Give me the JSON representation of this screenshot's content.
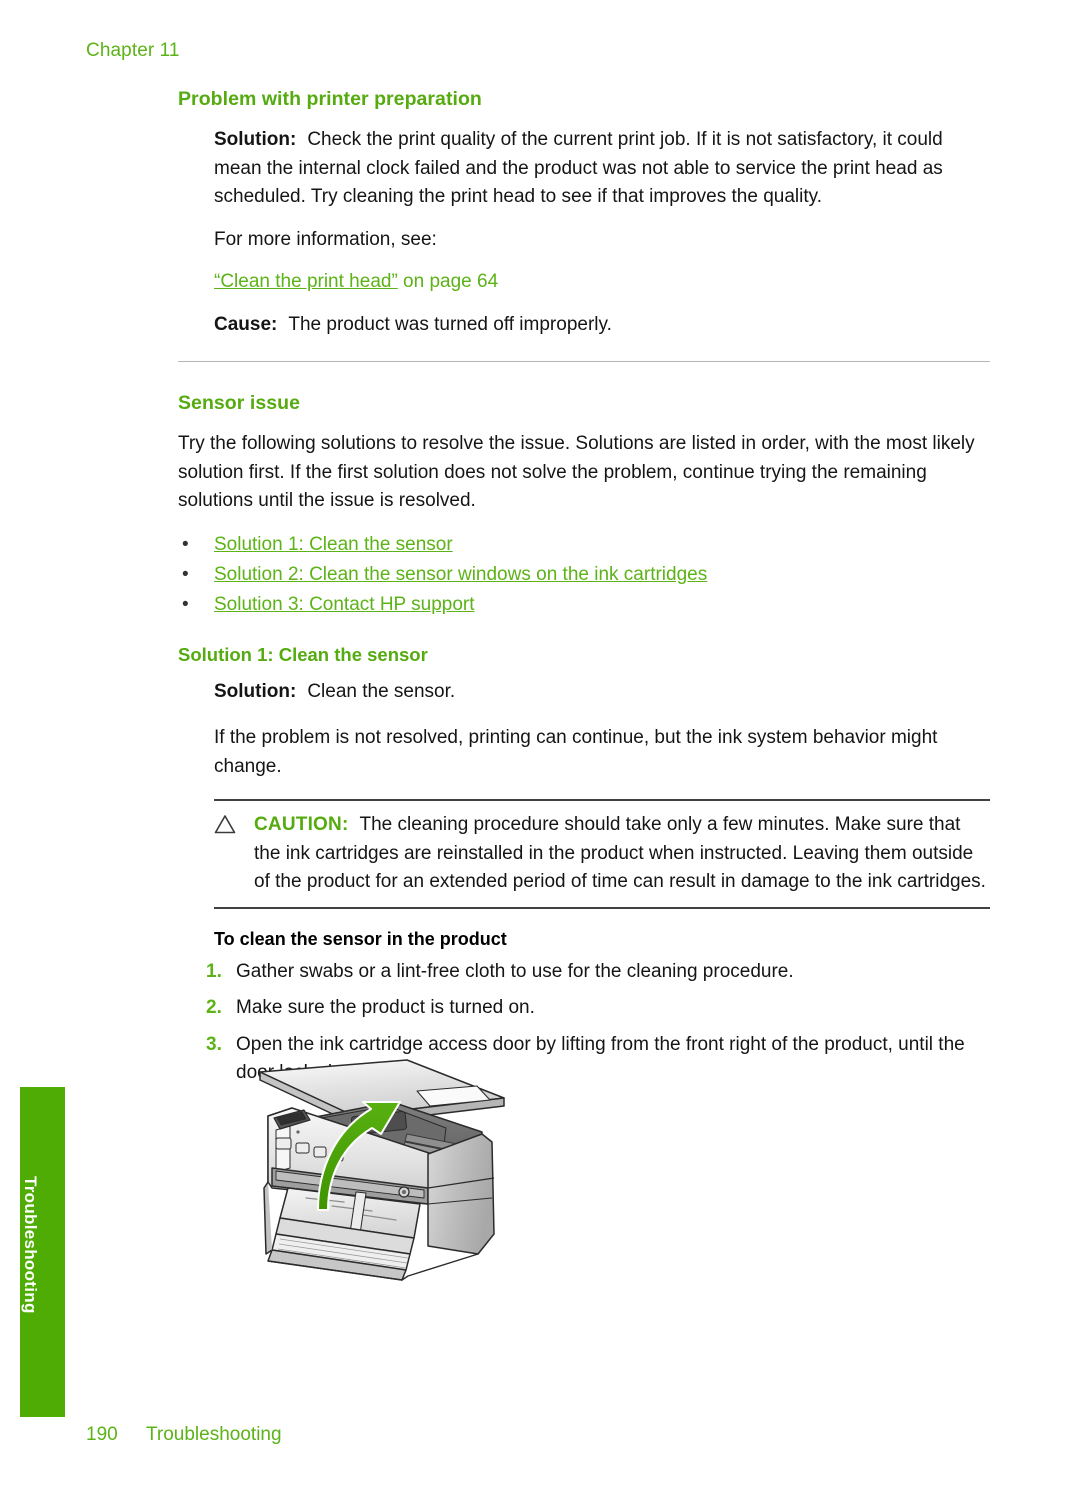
{
  "page": {
    "chapter_head": "Chapter 11",
    "footer_page_number": "190",
    "footer_section": "Troubleshooting",
    "side_tab_label": "Troubleshooting",
    "accent_green": "#5cb317",
    "heading_green": "#55ab10",
    "tab_green": "#4fac04"
  },
  "section_printer_prep": {
    "title": "Problem with printer preparation",
    "solution_label": "Solution:",
    "solution_text": "Check the print quality of the current print job. If it is not satisfactory, it could mean the internal clock failed and the product was not able to service the print head as scheduled. Try cleaning the print head to see if that improves the quality.",
    "more_info_text": "For more information, see:",
    "xref_quoted": "“Clean the print head”",
    "xref_tail": " on page 64",
    "cause_label": "Cause:",
    "cause_text": "The product was turned off improperly."
  },
  "section_sensor_issue": {
    "title": "Sensor issue",
    "intro": "Try the following solutions to resolve the issue. Solutions are listed in order, with the most likely solution first. If the first solution does not solve the problem, continue trying the remaining solutions until the issue is resolved.",
    "bullet_glyph": "•",
    "links": [
      "Solution 1: Clean the sensor",
      "Solution 2: Clean the sensor windows on the ink cartridges",
      "Solution 3: Contact HP support"
    ]
  },
  "solution_1": {
    "title": "Solution 1: Clean the sensor",
    "solution_label": "Solution:",
    "solution_text": "Clean the sensor.",
    "note_text": "If the problem is not resolved, printing can continue, but the ink system behavior might change.",
    "caution": {
      "icon": "warning-triangle-icon",
      "label": "CAUTION:",
      "text": "The cleaning procedure should take only a few minutes. Make sure that the ink cartridges are reinstalled in the product when instructed. Leaving them outside of the product for an extended period of time can result in damage to the ink cartridges."
    },
    "procedure_title": "To clean the sensor in the product",
    "steps": [
      {
        "num": "1.",
        "text": "Gather swabs or a lint-free cloth to use for the cleaning procedure."
      },
      {
        "num": "2.",
        "text": "Make sure the product is turned on."
      },
      {
        "num": "3.",
        "text": "Open the ink cartridge access door by lifting from the front right of the product, until the door locks into place."
      }
    ]
  },
  "figure": {
    "name": "printer-open-access-door-illustration",
    "description": "All-in-one printer with ink cartridge access door lifted open and a green curved arrow indicating upward lifting motion"
  }
}
